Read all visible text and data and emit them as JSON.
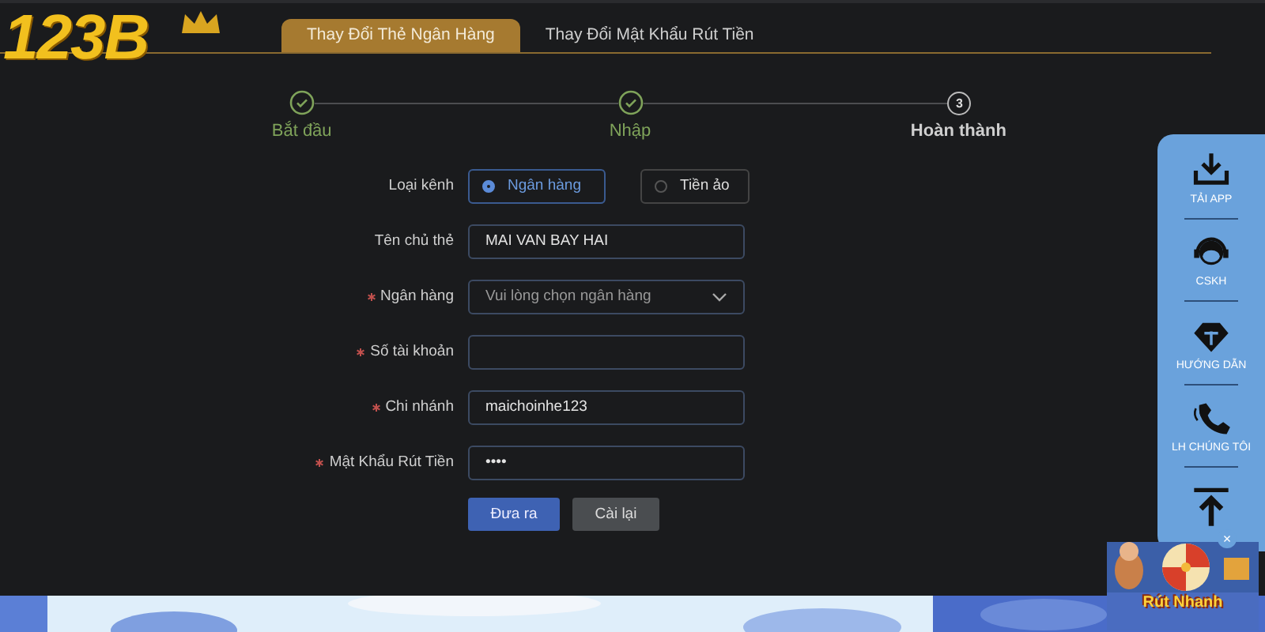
{
  "logo": {
    "text": "123B"
  },
  "tabs": [
    {
      "label": "Thay Đổi Thẻ Ngân Hàng",
      "selected": true
    },
    {
      "label": "Thay Đổi Mật Khẩu Rút Tiền",
      "selected": false
    }
  ],
  "steps": [
    {
      "label": "Bắt đầu",
      "kind": "done"
    },
    {
      "label": "Nhập",
      "kind": "done"
    },
    {
      "label": "Hoàn thành",
      "kind": "pending",
      "number": "3"
    }
  ],
  "form": {
    "channel": {
      "label": "Loại kênh",
      "options": [
        {
          "label": "Ngân hàng",
          "selected": true
        },
        {
          "label": "Tiền ảo",
          "selected": false
        }
      ]
    },
    "fields": [
      {
        "label": "Tên chủ thẻ",
        "required": false,
        "kind": "text",
        "value": "MAI VAN BAY HAI"
      },
      {
        "label": "Ngân hàng",
        "required": true,
        "kind": "select",
        "placeholder": "Vui lòng chọn ngân hàng"
      },
      {
        "label": "Số tài khoản",
        "required": true,
        "kind": "text"
      },
      {
        "label": "Chi nhánh",
        "required": true,
        "kind": "text",
        "value": "maichoinhe123"
      },
      {
        "label": "Mật Khẩu Rút Tiền",
        "required": true,
        "kind": "text",
        "value": "••••"
      }
    ],
    "buttons": [
      {
        "label": "Đưa ra",
        "kind": "primary"
      },
      {
        "label": "Cài lại",
        "kind": "secondary"
      }
    ]
  },
  "side_menu": [
    {
      "label": "TẢI APP",
      "kind": "download"
    },
    {
      "label": "CSKH",
      "kind": "support"
    },
    {
      "label": "HƯỚNG DẪN",
      "kind": "diamond"
    },
    {
      "label": "LH CHÚNG TÔI",
      "kind": "phone"
    },
    {
      "kind": "top"
    }
  ],
  "promo": {
    "text": "Rút Nhanh",
    "close": "×"
  }
}
